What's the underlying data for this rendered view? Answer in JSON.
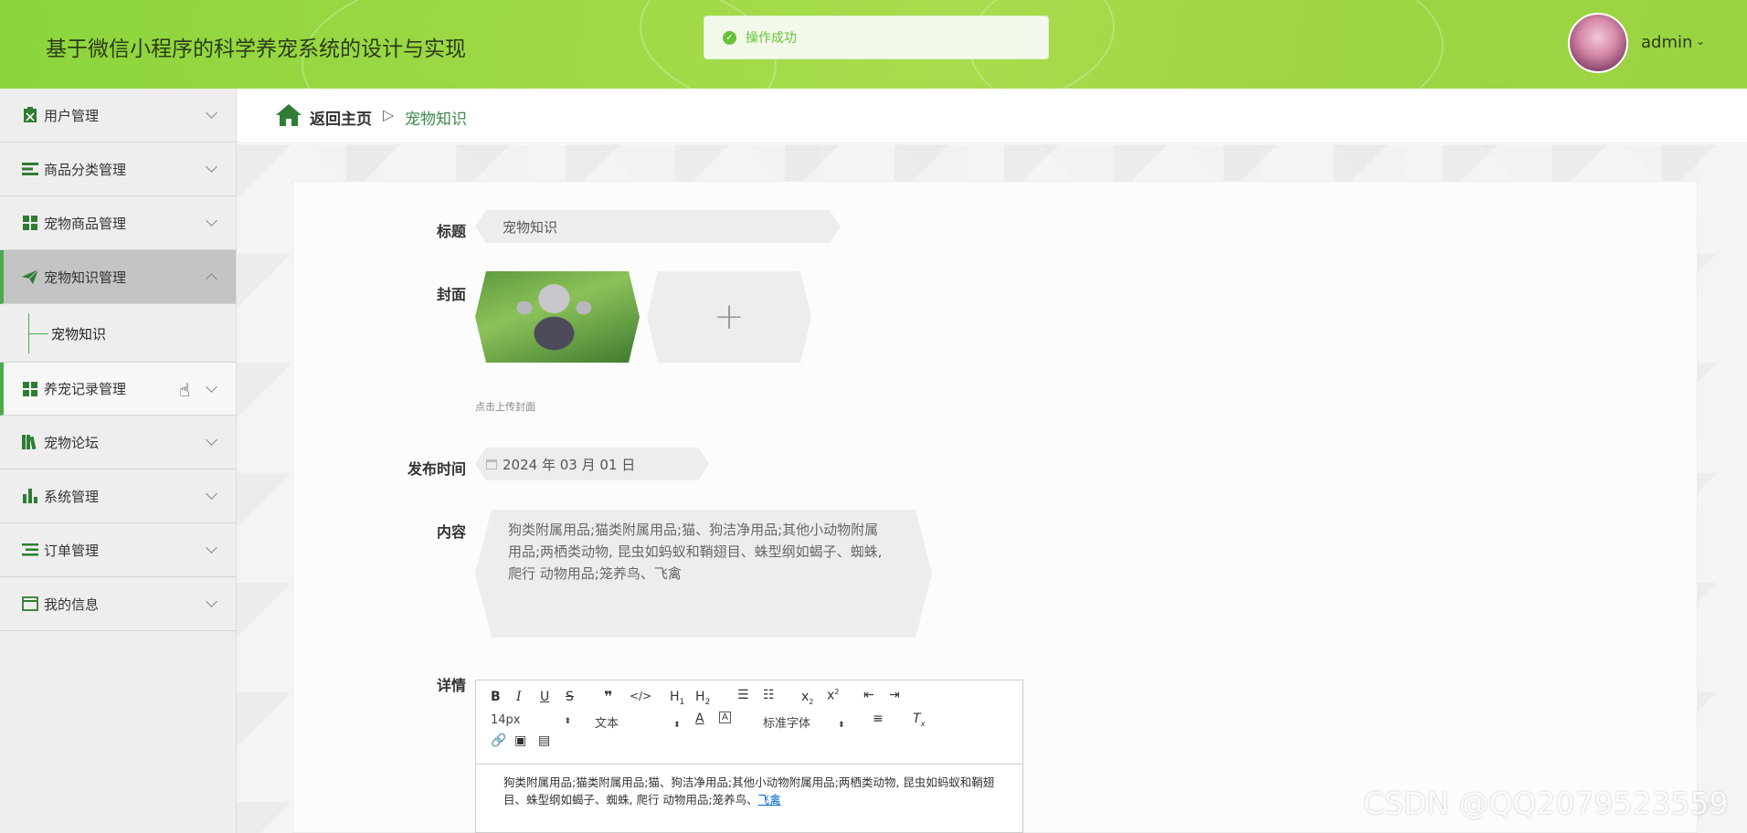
{
  "header": {
    "title": "基于微信小程序的科学养宠系统的设计与实现",
    "toast": "操作成功",
    "user": "admin"
  },
  "sidebar": {
    "items": [
      {
        "label": "用户管理",
        "icon": "clipboard-icon"
      },
      {
        "label": "商品分类管理",
        "icon": "list-icon"
      },
      {
        "label": "宠物商品管理",
        "icon": "grid-icon"
      },
      {
        "label": "宠物知识管理",
        "icon": "paper-plane-icon"
      },
      {
        "label": "养宠记录管理",
        "icon": "grid-icon"
      },
      {
        "label": "宠物论坛",
        "icon": "books-icon"
      },
      {
        "label": "系统管理",
        "icon": "bar-chart-icon"
      },
      {
        "label": "订单管理",
        "icon": "list-icon"
      },
      {
        "label": "我的信息",
        "icon": "card-icon"
      }
    ],
    "submenu": {
      "label": "宠物知识"
    }
  },
  "breadcrumb": {
    "home": "返回主页",
    "separator": "▷",
    "current": "宠物知识"
  },
  "form": {
    "title_label": "标题",
    "title_value": "宠物知识",
    "cover_label": "封面",
    "upload_plus": "+",
    "upload_hint": "点击上传封面",
    "date_label": "发布时间",
    "date_value": "2024 年 03 月 01 日",
    "content_label": "内容",
    "content_value": "狗类附属用品;猫类附属用品;猫、狗洁净用品;其他小动物附属用品;两栖类动物, 昆虫如蚂蚁和鞘翅目、蛛型纲如蝎子、蜘蛛, 爬行 动物用品;笼养鸟、飞禽",
    "detail_label": "详情"
  },
  "editor": {
    "font_size": "14px",
    "text_type": "文本",
    "font_family": "标准字体",
    "body_text": "狗类附属用品;猫类附属用品;猫、狗洁净用品;其他小动物附属用品;两栖类动物, 昆虫如蚂蚁和鞘翅目、蛛型纲如蝎子、蜘蛛, 爬行 动物用品;笼养鸟、",
    "body_link": "飞禽"
  },
  "watermark": "CSDN @QQ2079523559",
  "colors": {
    "accent": "#4caa4c",
    "header": "#9ed945",
    "success": "#67c23a"
  }
}
